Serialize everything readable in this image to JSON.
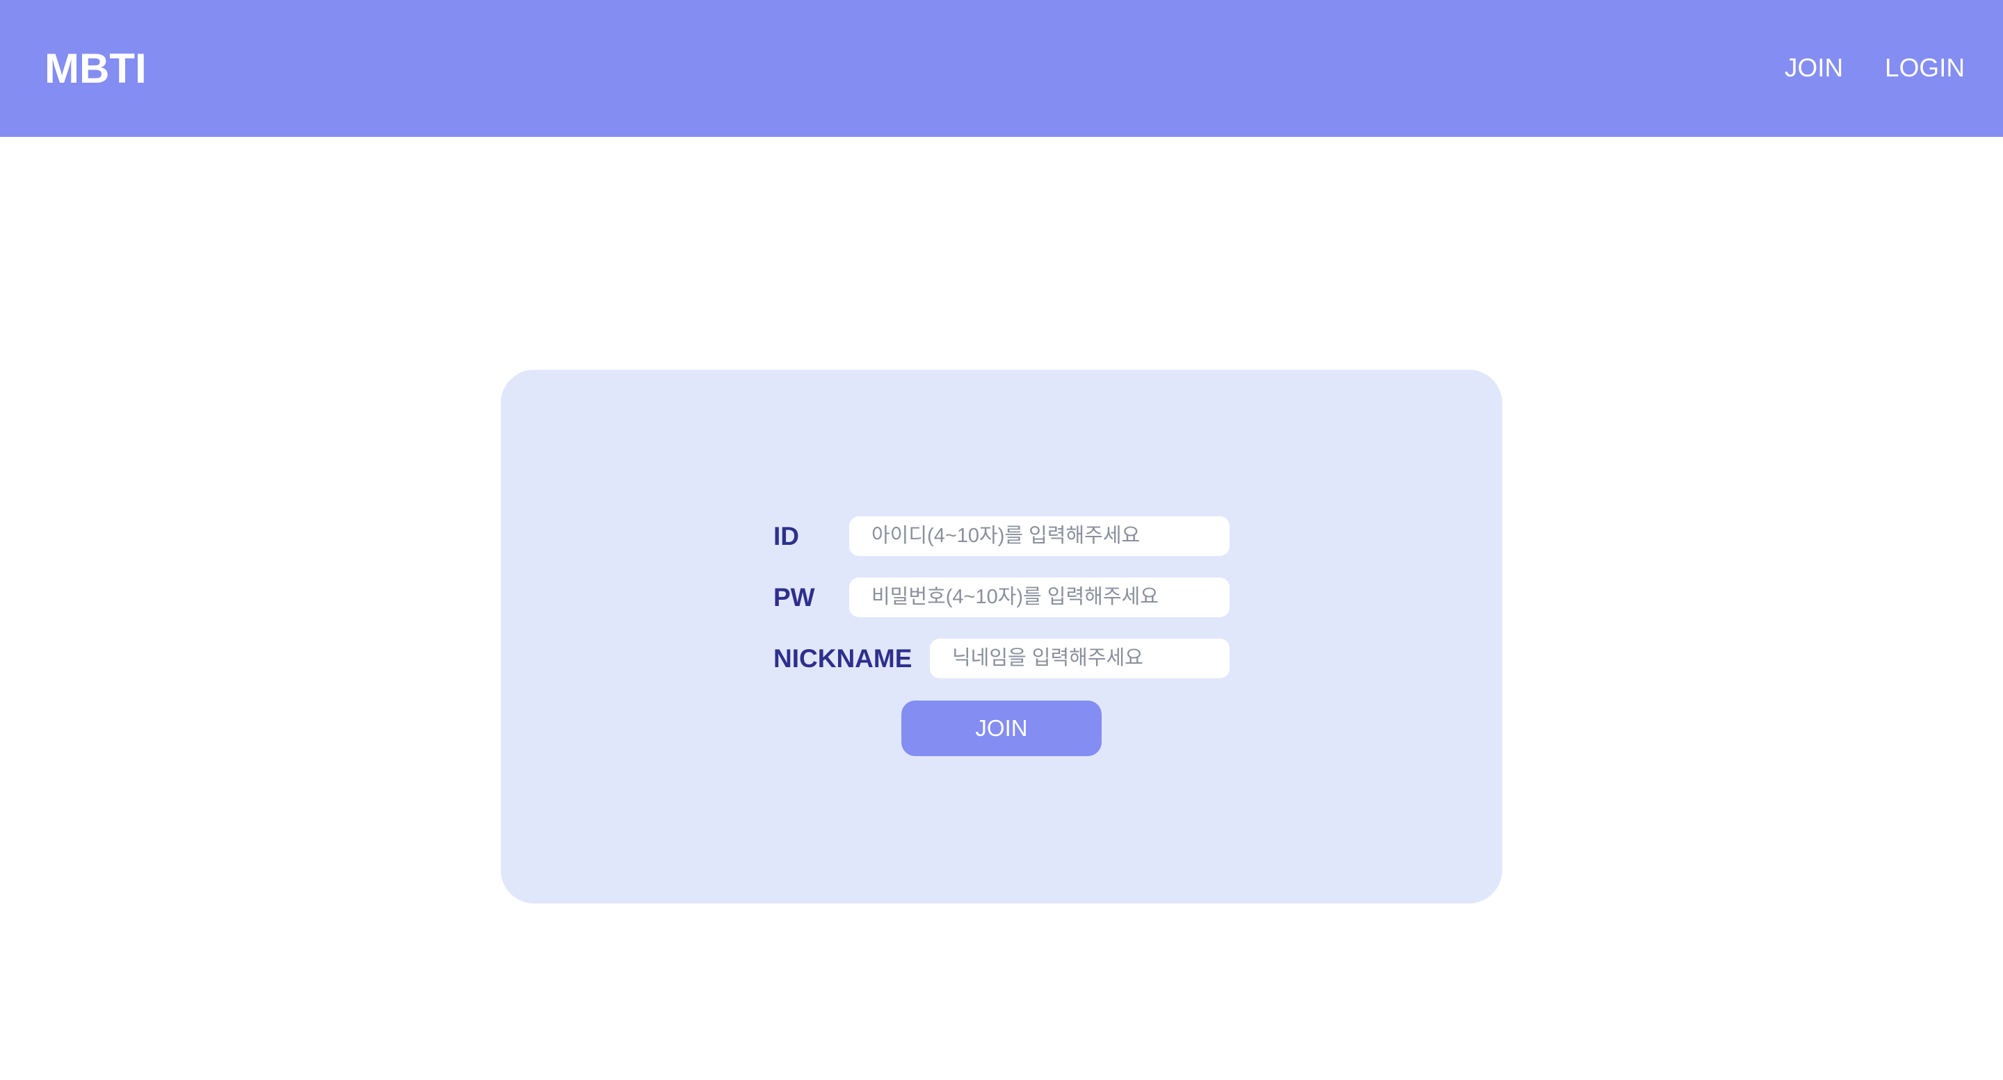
{
  "header": {
    "logo": "MBTI",
    "nav": {
      "join": "JOIN",
      "login": "LOGIN"
    },
    "background_color": "#838df2"
  },
  "join_form": {
    "card_color": "#e1e7fb",
    "label_color": "#2e2f8c",
    "id": {
      "label": "ID",
      "value": "",
      "placeholder": "아이디(4~10자)를 입력해주세요"
    },
    "pw": {
      "label": "PW",
      "value": "",
      "placeholder": "비밀번호(4~10자)를 입력해주세요"
    },
    "nickname": {
      "label": "NICKNAME",
      "value": "",
      "placeholder": "닉네임을 입력해주세요"
    },
    "submit_label": "JOIN"
  }
}
